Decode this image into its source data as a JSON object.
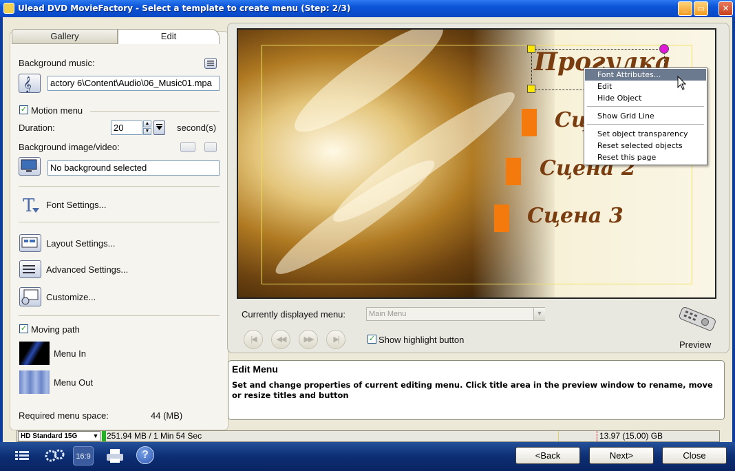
{
  "window": {
    "title": "Ulead DVD MovieFactory - Select a template to create menu (Step: 2/3)",
    "controls": {
      "minimize": "_",
      "maximize": "▭",
      "close": "✕"
    }
  },
  "left_panel": {
    "tabs": [
      "Gallery",
      "Edit"
    ],
    "active_tab": "Edit",
    "background_music": {
      "label": "Background music:",
      "value": "actory 6\\Content\\Audio\\06_Music01.mpa"
    },
    "motion_menu": {
      "label": "Motion menu",
      "checked": true
    },
    "duration": {
      "label": "Duration:",
      "value": "20",
      "unit": "second(s)"
    },
    "background_image": {
      "label": "Background image/video:",
      "value": "No background selected"
    },
    "font_settings": "Font Settings...",
    "layout_settings": "Layout Settings...",
    "advanced_settings": "Advanced Settings...",
    "customize": "Customize...",
    "moving_path": {
      "label": "Moving path",
      "checked": true
    },
    "menu_in": "Menu In",
    "menu_out": "Menu Out",
    "required_space": {
      "label": "Required menu space:",
      "value": "44 (MB)"
    }
  },
  "preview": {
    "title_text": "Прогулка",
    "scenes": [
      "Сцена 1",
      "Сцена 2",
      "Сцена 3"
    ],
    "context_menu": {
      "items": [
        "Font Attributes...",
        "Edit",
        "Hide Object",
        "Show Grid Line",
        "Set object transparency",
        "Reset selected objects",
        "Reset this page"
      ],
      "highlighted": "Font Attributes..."
    },
    "currently_displayed_label": "Currently displayed menu:",
    "currently_displayed_value": "Main Menu",
    "show_highlight": {
      "label": "Show highlight button",
      "checked": true
    },
    "preview_label": "Preview"
  },
  "info": {
    "title": "Edit Menu",
    "body": "Set and change properties of current editing menu. Click title area in the preview window to rename, move or resize titles and button"
  },
  "status": {
    "disc": "HD Standard 15G",
    "used": "251.94 MB / 1 Min 54 Sec",
    "capacity": "13.97 (15.00) GB"
  },
  "bottom": {
    "back": "<Back",
    "next": "Next>",
    "close": "Close",
    "icons": [
      "menu-list-icon",
      "settings-icon",
      "aspect-ratio-icon",
      "print-icon",
      "help-icon"
    ],
    "aspect_label": "16:9",
    "help_label": "?"
  },
  "colors": {
    "titlebar": "#0b54d8",
    "highlight_box": "#f47a0e",
    "handle": "#ffe600",
    "rotate_handle": "#e01ad8",
    "menu_selection": "#6b7a8f"
  }
}
